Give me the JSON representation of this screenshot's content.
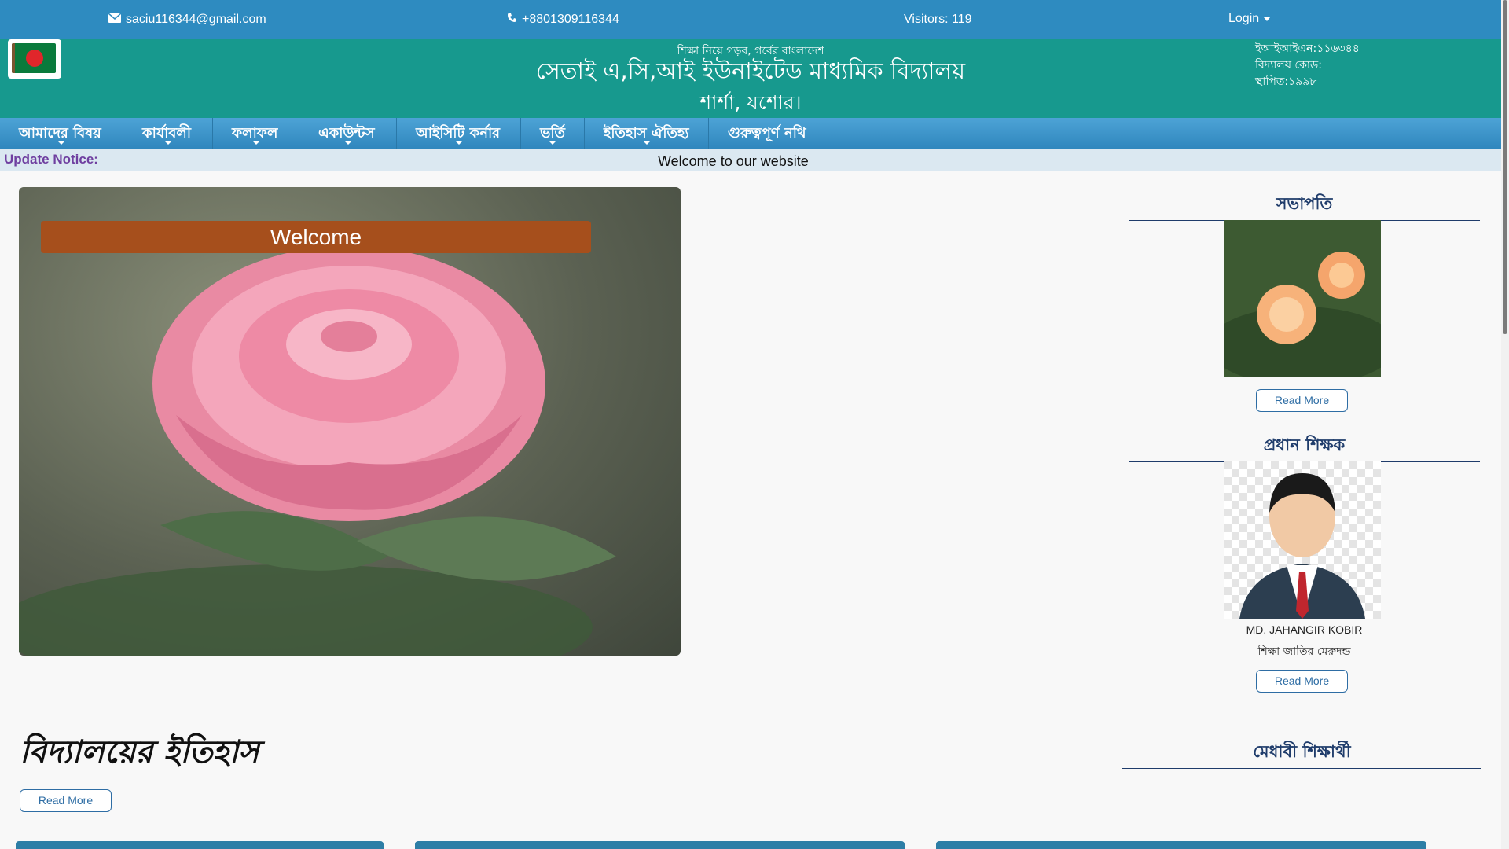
{
  "topbar": {
    "email": "saciu116344@gmail.com",
    "phone": "+8801309116344",
    "visitors": "Visitors: 119",
    "login": "Login"
  },
  "header": {
    "motto": "শিক্ষা নিয়ে গড়ব, গর্বের বাংলাদেশ",
    "school_name": "সেতাই এ,সি,আই ইউনাইটেড মাধ্যমিক বিদ্যালয়",
    "school_place": "শার্শা, যশোর।",
    "eiin": "ইআইআইএন:১১৬৩৪৪",
    "school_code": "বিদ্যালয় কোড:",
    "established": "স্থাপিত:১৯৯৮"
  },
  "nav": {
    "items": [
      {
        "label": "আমাদের বিষয়"
      },
      {
        "label": "কার্যাবলী"
      },
      {
        "label": "ফলাফল"
      },
      {
        "label": "একাউন্টস"
      },
      {
        "label": "আইসিটি কর্নার"
      },
      {
        "label": "ভর্তি"
      },
      {
        "label": "ইতিহাস ঐতিহ্য"
      },
      {
        "label": "গুরুত্বপূর্ণ নথি"
      }
    ]
  },
  "notice": {
    "label": "Update Notice:",
    "text": "Welcome to our website"
  },
  "slider": {
    "caption": "Welcome"
  },
  "sidebar": {
    "president_title": "সভাপতি",
    "president_read_more": "Read More",
    "headmaster_title": "প্রধান শিক্ষক",
    "headmaster_name": "MD. JAHANGIR KOBIR",
    "headmaster_quote": "শিক্ষা জাতির মেরুদন্ড",
    "headmaster_read_more": "Read More",
    "meritorious_title": "মেধাবী শিক্ষার্থী"
  },
  "history": {
    "title": "বিদ্যালয়ের ইতিহাস",
    "read_more": "Read More"
  },
  "colors": {
    "topbar": "#2e8bc0",
    "header": "#17998e",
    "nav": "#3a94cb",
    "caption": "#a64f1c",
    "sidebar_title": "#1f3c6b"
  },
  "icons": {
    "email": "envelope-icon",
    "phone": "phone-icon",
    "login_caret": "caret-down-icon"
  }
}
